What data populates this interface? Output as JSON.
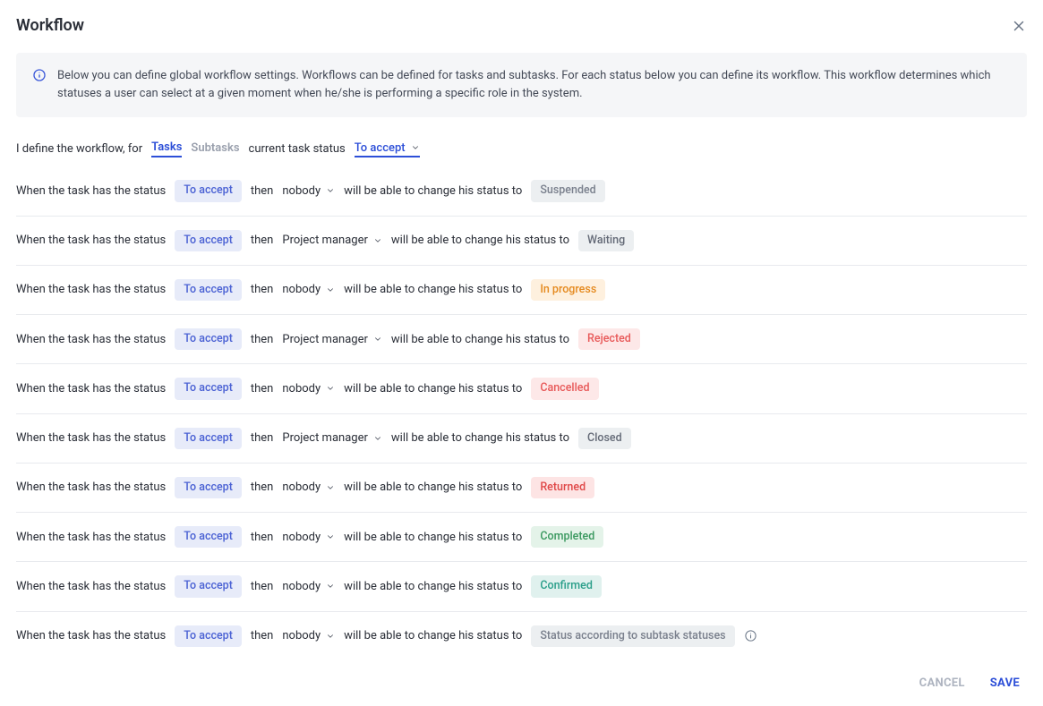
{
  "title": "Workflow",
  "info_text": "Below you can define global workflow settings. Workflows can be defined for tasks and subtasks. For each status below you can define its workflow. This workflow determines which statuses a user can select at a given moment when he/she is performing a specific role in the system.",
  "define_prefix": "I define the workflow, for",
  "tabs": {
    "tasks": "Tasks",
    "subtasks": "Subtasks"
  },
  "define_mid": "current task status",
  "status_selected": "To accept",
  "rule_prefix": "When the task has the status",
  "rule_then": "then",
  "rule_suffix_nobody": "will be able to change his status to",
  "rule_suffix_role": "will be able to change his status to",
  "rules": [
    {
      "from": "To accept",
      "role": "nobody",
      "target": "Suspended",
      "bg": "#eceff1",
      "fg": "#7a808d"
    },
    {
      "from": "To accept",
      "role": "Project manager",
      "target": "Waiting",
      "bg": "#eceff1",
      "fg": "#656b78"
    },
    {
      "from": "To accept",
      "role": "nobody",
      "target": "In progress",
      "bg": "#fef0de",
      "fg": "#e58a1f"
    },
    {
      "from": "To accept",
      "role": "Project manager",
      "target": "Rejected",
      "bg": "#fde8e8",
      "fg": "#e85a5a"
    },
    {
      "from": "To accept",
      "role": "nobody",
      "target": "Cancelled",
      "bg": "#fde8e8",
      "fg": "#e85a5a"
    },
    {
      "from": "To accept",
      "role": "Project manager",
      "target": "Closed",
      "bg": "#eceff1",
      "fg": "#656b78"
    },
    {
      "from": "To accept",
      "role": "nobody",
      "target": "Returned",
      "bg": "#fde4e4",
      "fg": "#e04848"
    },
    {
      "from": "To accept",
      "role": "nobody",
      "target": "Completed",
      "bg": "#e4f3e9",
      "fg": "#3b9960"
    },
    {
      "from": "To accept",
      "role": "nobody",
      "target": "Confirmed",
      "bg": "#e0f1ee",
      "fg": "#2b9f8a"
    },
    {
      "from": "To accept",
      "role": "nobody",
      "target": "Status according to subtask statuses",
      "bg": "#eceff1",
      "fg": "#7a808d",
      "info": true
    }
  ],
  "footer": {
    "cancel": "CANCEL",
    "save": "SAVE"
  }
}
